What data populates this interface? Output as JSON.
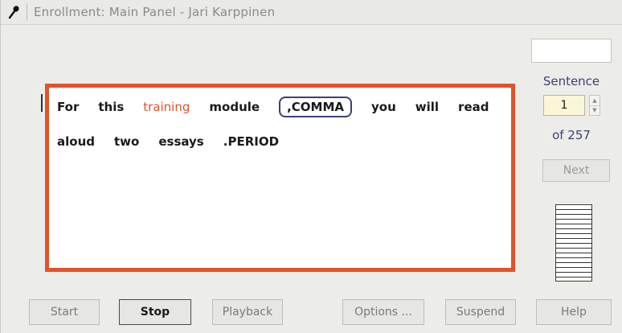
{
  "window": {
    "title": "Enrollment: Main Panel  -  Jari Karppinen",
    "icon": "microphone-icon"
  },
  "text_panel": {
    "line1": [
      {
        "text": "For",
        "style": "normal"
      },
      {
        "text": "this",
        "style": "normal"
      },
      {
        "text": "training",
        "style": "highlight"
      },
      {
        "text": "module",
        "style": "normal"
      },
      {
        "text": ",COMMA",
        "style": "boxed"
      },
      {
        "text": "you",
        "style": "normal"
      },
      {
        "text": "will",
        "style": "normal"
      },
      {
        "text": "read",
        "style": "normal"
      }
    ],
    "line2": [
      {
        "text": "aloud",
        "style": "normal"
      },
      {
        "text": "two",
        "style": "normal"
      },
      {
        "text": "essays",
        "style": "normal"
      },
      {
        "text": ".PERIOD",
        "style": "normal"
      }
    ],
    "border_color": "#e0532b",
    "highlight_color": "#e0532b"
  },
  "sidebar": {
    "sentence_label": "Sentence",
    "sentence_value": "1",
    "of_label": "of 257",
    "next_label": "Next"
  },
  "buttons": {
    "start": "Start",
    "stop": "Stop",
    "playback": "Playback",
    "options": "Options ...",
    "suspend": "Suspend",
    "help": "Help"
  },
  "colors": {
    "accent_blue": "#3c3f7a",
    "accent_orange": "#e0532b"
  }
}
